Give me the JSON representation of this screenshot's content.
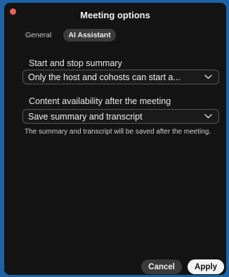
{
  "window": {
    "title": "Meeting options"
  },
  "tabs": [
    {
      "label": "General",
      "active": false
    },
    {
      "label": "AI Assistant",
      "active": true
    }
  ],
  "summary_control": {
    "label": "Start and stop summary",
    "value": "Only the host and cohosts can start a..."
  },
  "availability": {
    "label": "Content availability after the meeting",
    "value": "Save summary and transcript",
    "help": "The summary and transcript will be saved after the meeting."
  },
  "footer": {
    "cancel_label": "Cancel",
    "apply_label": "Apply"
  },
  "icons": {
    "close": "close-dot-icon",
    "dropdown": "chevron-down-icon"
  },
  "colors": {
    "background": "#141414",
    "frame": "#1d63a5",
    "close_dot": "#ee5d58",
    "apply_button": "#f2f2f2"
  }
}
